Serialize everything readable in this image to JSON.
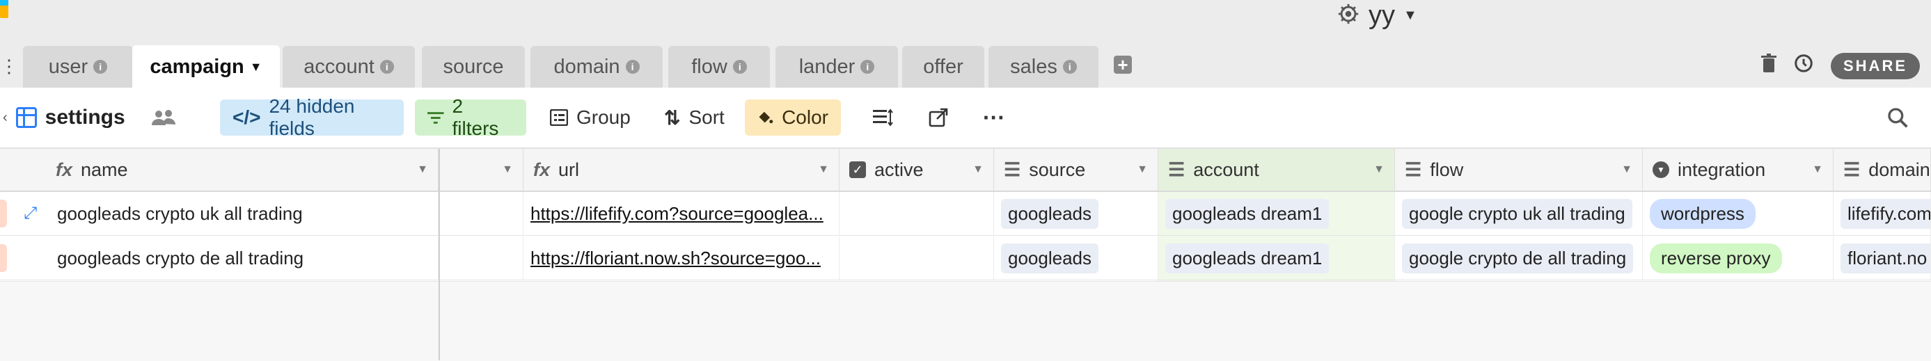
{
  "user": {
    "name": "yy"
  },
  "tabs": [
    {
      "label": "user",
      "info": true,
      "active": false
    },
    {
      "label": "campaign",
      "info": false,
      "active": true
    },
    {
      "label": "account",
      "info": true,
      "active": false
    },
    {
      "label": "source",
      "info": false,
      "active": false
    },
    {
      "label": "domain",
      "info": true,
      "active": false
    },
    {
      "label": "flow",
      "info": true,
      "active": false
    },
    {
      "label": "lander",
      "info": true,
      "active": false
    },
    {
      "label": "offer",
      "info": false,
      "active": false
    },
    {
      "label": "sales",
      "info": true,
      "active": false
    }
  ],
  "share_label": "SHARE",
  "toolbar": {
    "view_name": "settings",
    "hidden_fields": "24 hidden fields",
    "filters": "2 filters",
    "group": "Group",
    "sort": "Sort",
    "color": "Color"
  },
  "columns": {
    "name": "name",
    "url": "url",
    "active": "active",
    "source": "source",
    "account": "account",
    "flow": "flow",
    "integration": "integration",
    "domain": "domain"
  },
  "rows": [
    {
      "name": "googleads crypto uk all trading",
      "url": "https://lifefify.com?source=googlea...",
      "source": "googleads",
      "account": "googleads dream1",
      "flow": "google crypto uk all trading",
      "integration": "wordpress",
      "domain": "lifefify.com"
    },
    {
      "name": "googleads crypto de all trading",
      "url": "https://floriant.now.sh?source=goo...",
      "source": "googleads",
      "account": "googleads dream1",
      "flow": "google crypto de all trading",
      "integration": "reverse proxy",
      "domain": "floriant.no"
    }
  ],
  "colors": {
    "accent_blue": "#2d7ff9",
    "hidden_fields_bg": "#d1e9f9",
    "filters_bg": "#d1f1cc",
    "color_btn_bg": "#fde8b9",
    "integration_wordpress": "#cfdfff",
    "integration_reverse_proxy": "#d1f7c4"
  }
}
